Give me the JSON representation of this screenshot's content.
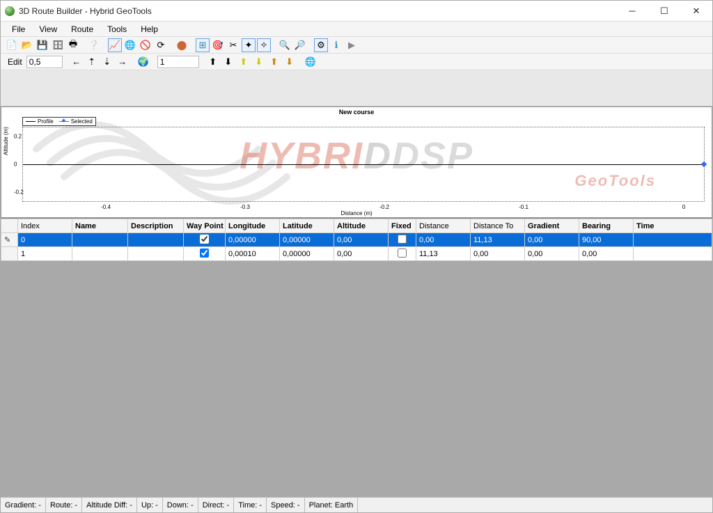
{
  "title": "3D Route Builder - Hybrid GeoTools",
  "menubar": [
    "File",
    "View",
    "Route",
    "Tools",
    "Help"
  ],
  "toolbar1": {
    "edit_label": "Edit",
    "edit_value": "0,5",
    "spin_value": "1"
  },
  "chart_data": {
    "type": "line",
    "title": "New course",
    "xlabel": "Distance (m)",
    "ylabel": "Altitude (m)",
    "xlim": [
      -0.5,
      0.0
    ],
    "ylim": [
      -0.3,
      0.3
    ],
    "xticks": [
      -0.4,
      -0.3,
      -0.2,
      -0.1,
      0.0
    ],
    "yticks": [
      -0.2,
      0.0,
      0.2
    ],
    "legend": [
      "Profile",
      "Selected"
    ],
    "series": [
      {
        "name": "Profile",
        "x": [
          -0.5,
          0.0
        ],
        "y": [
          0.0,
          0.0
        ]
      },
      {
        "name": "Selected",
        "x": [
          0.0
        ],
        "y": [
          0.0
        ]
      }
    ],
    "watermark": {
      "big": "HYBRIDDSP",
      "small": "GeoTools"
    }
  },
  "table": {
    "columns": [
      {
        "label": "Index",
        "bold": false
      },
      {
        "label": "Name",
        "bold": true
      },
      {
        "label": "Description",
        "bold": true
      },
      {
        "label": "Way Point",
        "bold": true
      },
      {
        "label": "Longitude",
        "bold": true
      },
      {
        "label": "Latitude",
        "bold": true
      },
      {
        "label": "Altitude",
        "bold": true
      },
      {
        "label": "Fixed",
        "bold": true
      },
      {
        "label": "Distance",
        "bold": false
      },
      {
        "label": "Distance To",
        "bold": false
      },
      {
        "label": "Gradient",
        "bold": true
      },
      {
        "label": "Bearing",
        "bold": true
      },
      {
        "label": "Time",
        "bold": true
      }
    ],
    "rows": [
      {
        "selected": true,
        "idx": "0",
        "name": "",
        "desc": "",
        "wp": true,
        "lon": "0,00000",
        "lat": "0,00000",
        "alt": "0,00",
        "fixed": false,
        "dist": "0,00",
        "distTo": "11,13",
        "grad": "0,00",
        "bear": "90,00",
        "time": ""
      },
      {
        "selected": false,
        "idx": "1",
        "name": "",
        "desc": "",
        "wp": true,
        "lon": "0,00010",
        "lat": "0,00000",
        "alt": "0,00",
        "fixed": false,
        "dist": "11,13",
        "distTo": "0,00",
        "grad": "0,00",
        "bear": "0,00",
        "time": ""
      }
    ]
  },
  "statusbar": {
    "gradient": "Gradient: -",
    "route": "Route: -",
    "altdiff": "Altitude Diff: -",
    "up": "Up: -",
    "down": "Down: -",
    "direct": "Direct: -",
    "time": "Time: -",
    "speed": "Speed: -",
    "planet": "Planet: Earth"
  }
}
